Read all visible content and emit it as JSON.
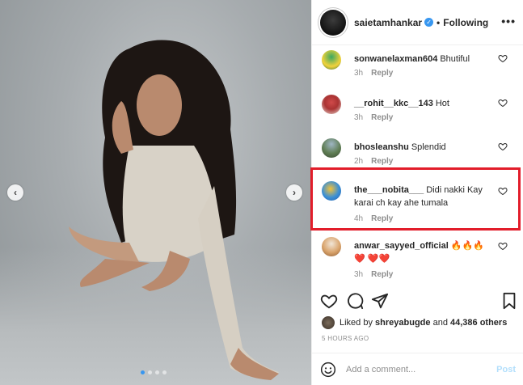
{
  "post": {
    "username": "saietamhankar",
    "separator": "•",
    "follow_status": "Following",
    "more_glyph": "•••"
  },
  "carousel": {
    "prev_glyph": "‹",
    "next_glyph": "›",
    "slide_count": 4,
    "active_slide": 1
  },
  "comments": [
    {
      "user": "sonwanelaxman604",
      "text": "Bhutiful",
      "time": "3h",
      "reply": "Reply"
    },
    {
      "user": "__rohit__kkc__143",
      "text": "Hot",
      "time": "3h",
      "reply": "Reply"
    },
    {
      "user": "bhosleanshu",
      "text": "Splendid",
      "time": "2h",
      "reply": "Reply"
    },
    {
      "user": "the___nobita___",
      "text": "Didi nakki Kay karai ch kay ahe tumala",
      "time": "4h",
      "reply": "Reply"
    },
    {
      "user": "anwar_sayyed_official",
      "text": "🔥🔥🔥❤️ ❤️❤️",
      "time": "3h",
      "reply": "Reply"
    }
  ],
  "likes": {
    "prefix": "Liked by",
    "user": "shreyabugde",
    "connector": "and",
    "count": "44,386 others"
  },
  "timestamp": "5 HOURS AGO",
  "add_comment": {
    "placeholder": "Add a comment...",
    "post_label": "Post"
  },
  "colors": {
    "highlight": "#e21d2a",
    "verified": "#3897f0",
    "post_disabled": "#b2dffc"
  }
}
